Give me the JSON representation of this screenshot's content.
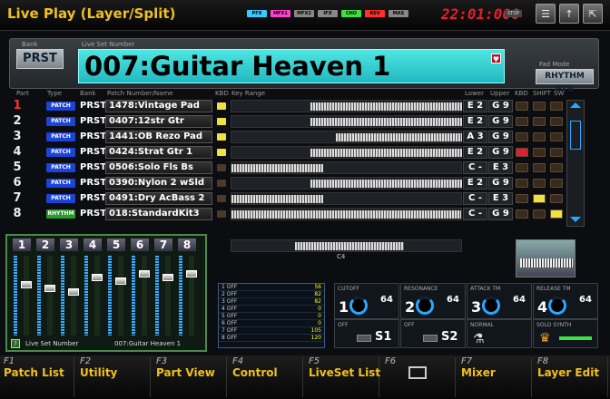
{
  "title": "Live Play (Layer/Split)",
  "indicators": [
    {
      "label": "PFX",
      "color": "#38c9ff"
    },
    {
      "label": "MFX1",
      "color": "#ff44cc"
    },
    {
      "label": "MFX2",
      "color": "#888888"
    },
    {
      "label": "IFX",
      "color": "#888888"
    },
    {
      "label": "CHO",
      "color": "#40e040"
    },
    {
      "label": "REV",
      "color": "#ff3030"
    },
    {
      "label": "MAS",
      "color": "#888888"
    }
  ],
  "clock": "22:01:000",
  "stop_label": "STOP",
  "header": {
    "bank_label": "Bank",
    "bank_value": "PRST",
    "liveset_label": "Live Set Number",
    "liveset_value": "007:Guitar Heaven 1",
    "fade_label": "Fad Mode",
    "fade_value": "RHYTHM PTN"
  },
  "columns": [
    "Part",
    "Type",
    "Bank",
    "Patch Number/Name",
    "KBD",
    "Key Range",
    "Lower",
    "Upper",
    "KBD",
    "SHIFT",
    "SW"
  ],
  "parts": [
    {
      "num": "1",
      "type": "PATCH",
      "bank": "PRST",
      "patch": "1478:Vintage Pad",
      "kbd": "on",
      "lower": "E 2",
      "upper": "G 9",
      "r0": 0.34,
      "r1": 1.0,
      "led": 0
    },
    {
      "num": "2",
      "type": "PATCH",
      "bank": "PRST",
      "patch": "0407:12str Gtr",
      "kbd": "on",
      "lower": "E 2",
      "upper": "G 9",
      "r0": 0.34,
      "r1": 1.0,
      "led": 0
    },
    {
      "num": "3",
      "type": "PATCH",
      "bank": "PRST",
      "patch": "1441:OB Rezo Pad",
      "kbd": "on",
      "lower": "A 3",
      "upper": "G 9",
      "r0": 0.45,
      "r1": 1.0,
      "led": 0
    },
    {
      "num": "4",
      "type": "PATCH",
      "bank": "PRST",
      "patch": "0424:Strat Gtr 1",
      "kbd": "on",
      "lower": "E 2",
      "upper": "G 9",
      "r0": 0.34,
      "r1": 1.0,
      "led": 1
    },
    {
      "num": "5",
      "type": "PATCH",
      "bank": "PRST",
      "patch": "0506:Solo Fls Bs",
      "kbd": "off",
      "lower": "C -",
      "upper": "E 3",
      "r0": 0.0,
      "r1": 0.4,
      "led": 0
    },
    {
      "num": "6",
      "type": "PATCH",
      "bank": "PRST",
      "patch": "0390:Nylon 2 wSld",
      "kbd": "off",
      "lower": "E 2",
      "upper": "G 9",
      "r0": 0.34,
      "r1": 1.0,
      "led": 0
    },
    {
      "num": "7",
      "type": "PATCH",
      "bank": "PRST",
      "patch": "0491:Dry AcBass 2",
      "kbd": "off",
      "lower": "C -",
      "upper": "E 3",
      "r0": 0.0,
      "r1": 0.4,
      "led": 2
    },
    {
      "num": "8",
      "type": "RHYTHM",
      "bank": "PRST",
      "patch": "018:StandardKit3",
      "kbd": "off",
      "lower": "C -",
      "upper": "G 9",
      "r0": 0.0,
      "r1": 1.0,
      "led": 2
    }
  ],
  "keyboard_note": "C4",
  "mixer": {
    "channels": [
      "1",
      "2",
      "3",
      "4",
      "5",
      "6",
      "7",
      "8"
    ],
    "levels": [
      0.65,
      0.6,
      0.55,
      0.75,
      0.7,
      0.8,
      0.75,
      0.8
    ],
    "footer_label": "Live Set Number",
    "footer_value": "007:Guitar Heaven 1",
    "help_icon": "?"
  },
  "cc_list": [
    {
      "label": "1 OFF",
      "value": "56"
    },
    {
      "label": "2 OFF",
      "value": "82"
    },
    {
      "label": "3 OFF",
      "value": "82"
    },
    {
      "label": "4 OFF",
      "value": "0"
    },
    {
      "label": "5 OFF",
      "value": "0"
    },
    {
      "label": "6 OFF",
      "value": "0"
    },
    {
      "label": "7 OFF",
      "value": "105"
    },
    {
      "label": "8 OFF",
      "value": "120"
    }
  ],
  "knobs": [
    {
      "label": "CUTOFF",
      "num": "1",
      "value": "64"
    },
    {
      "label": "RESONANCE",
      "num": "2",
      "value": "64"
    },
    {
      "label": "ATTACK TM",
      "num": "3",
      "value": "64"
    },
    {
      "label": "RELEASE TM",
      "num": "4",
      "value": "64"
    }
  ],
  "switches": [
    {
      "label": "OFF",
      "name": "S1"
    },
    {
      "label": "OFF",
      "name": "S2"
    },
    {
      "label": "NORMAL",
      "name": ""
    },
    {
      "label": "SOLO SYNTH",
      "name": ""
    }
  ],
  "fkeys": [
    {
      "num": "F1",
      "label": "Patch List"
    },
    {
      "num": "F2",
      "label": "Utility"
    },
    {
      "num": "F3",
      "label": "Part View"
    },
    {
      "num": "F4",
      "label": "Control"
    },
    {
      "num": "F5",
      "label": "LiveSet List"
    },
    {
      "num": "F6",
      "label": ""
    },
    {
      "num": "F7",
      "label": "Mixer"
    },
    {
      "num": "F8",
      "label": "Layer Edit"
    }
  ],
  "colors": {
    "accent": "#f0c020",
    "patch": "#1c44d8",
    "rhythm": "#2a9a2a",
    "clock": "#e81e2a"
  }
}
